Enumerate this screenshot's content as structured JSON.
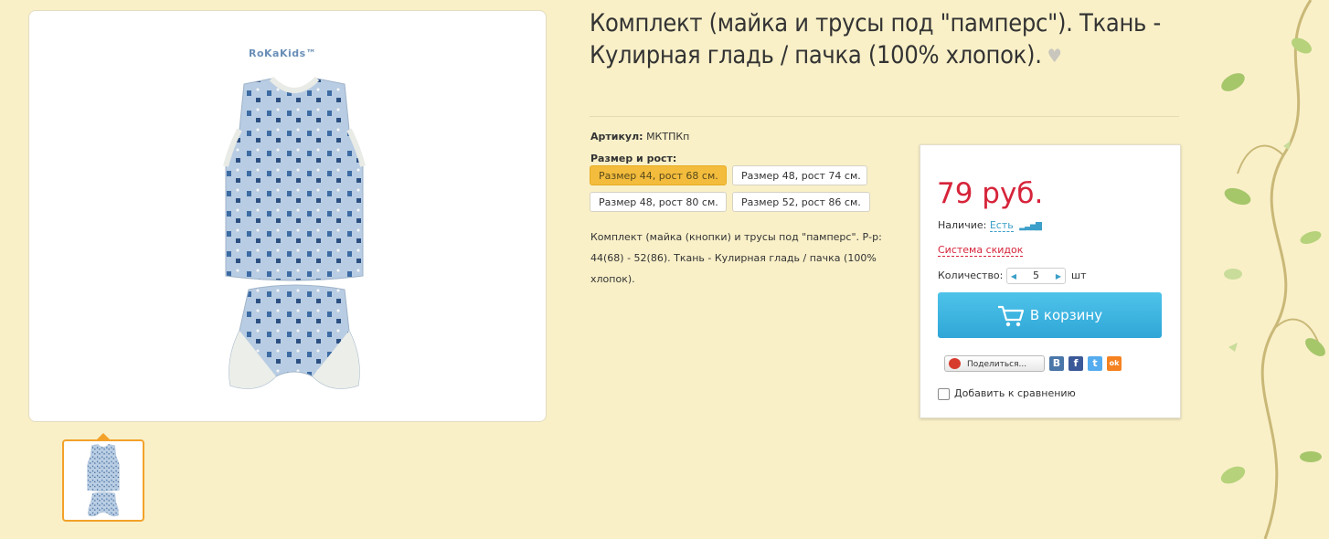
{
  "product": {
    "title": "Комплект (майка и трусы под \"памперс\"). Ткань - Кулирная гладь / пачка (100% хлопок).",
    "brand_logo": "RoKaKids™",
    "sku_label": "Артикул:",
    "sku_value": "МКТПКп",
    "size_label": "Размер и рост:",
    "sizes": [
      {
        "label": "Размер 44, рост 68 см.",
        "selected": true
      },
      {
        "label": "Размер 48, рост 74 см.",
        "selected": false
      },
      {
        "label": "Размер 48, рост 80 см.",
        "selected": false
      },
      {
        "label": "Размер 52, рост 86 см.",
        "selected": false
      }
    ],
    "description": "Комплект (майка (кнопки) и трусы под \"памперс\". Р-р: 44(68) - 52(86). Ткань - Кулирная гладь / пачка (100% хлопок)."
  },
  "buy": {
    "price": "79 руб.",
    "availability_label": "Наличие:",
    "availability_value": "Есть",
    "discount_link": "Система скидок",
    "quantity_label": "Количество:",
    "quantity_value": "5",
    "quantity_unit": "шт",
    "cart_button": "В корзину",
    "share_label": "Поделиться...",
    "social": [
      {
        "name": "vk",
        "glyph": "В",
        "color": "#4a76a8"
      },
      {
        "name": "facebook",
        "glyph": "f",
        "color": "#3b5998"
      },
      {
        "name": "twitter",
        "glyph": "t",
        "color": "#55acee"
      },
      {
        "name": "odnoklassniki",
        "glyph": "ok",
        "color": "#f58220"
      }
    ],
    "compare_label": "Добавить к сравнению"
  },
  "colors": {
    "background": "#f9f0c8",
    "accent_blue": "#3c9fc9",
    "price_red": "#d6243a",
    "selected_size": "#f3bc3c",
    "thumb_border": "#f3a229"
  }
}
